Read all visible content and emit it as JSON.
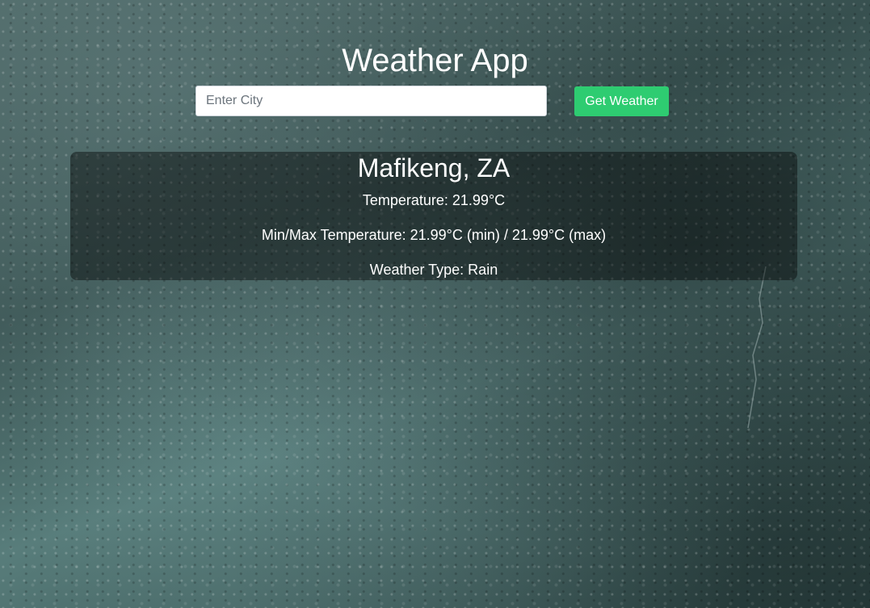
{
  "app": {
    "title": "Weather App"
  },
  "search": {
    "placeholder": "Enter City",
    "value": "",
    "button_label": "Get Weather"
  },
  "weather": {
    "city": "Mafikeng, ZA",
    "temperature_line": "Temperature: 21.99°C",
    "minmax_line": "Min/Max Temperature: 21.99°C (min) / 21.99°C (max)",
    "type_line": "Weather Type: Rain"
  },
  "colors": {
    "button_bg": "#2ecc71",
    "text": "#ffffff",
    "card_bg": "rgba(0,0,0,0.42)"
  }
}
